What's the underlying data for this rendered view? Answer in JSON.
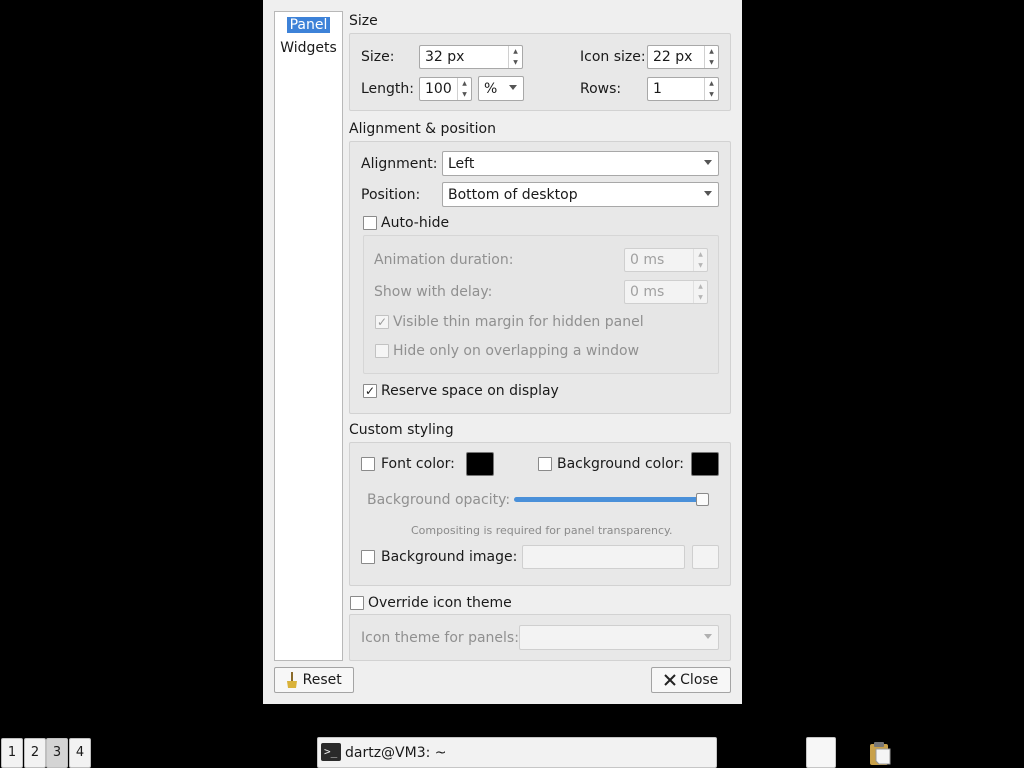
{
  "nav": {
    "items": [
      {
        "label": "Panel",
        "selected": true
      },
      {
        "label": "Widgets",
        "selected": false
      }
    ]
  },
  "size_section": {
    "title": "Size",
    "size_label": "Size:",
    "size_value": "32 px",
    "icon_size_label": "Icon size:",
    "icon_size_value": "22 px",
    "length_label": "Length:",
    "length_value": "100",
    "length_unit": "%",
    "rows_label": "Rows:",
    "rows_value": "1"
  },
  "alignment_section": {
    "title": "Alignment & position",
    "alignment_label": "Alignment:",
    "alignment_value": "Left",
    "position_label": "Position:",
    "position_value": "Bottom of desktop",
    "autohide_label": "Auto-hide",
    "autohide_checked": false,
    "animation_label": "Animation duration:",
    "animation_value": "0 ms",
    "show_delay_label": "Show with delay:",
    "show_delay_value": "0 ms",
    "thin_margin_label": "Visible thin margin for hidden panel",
    "thin_margin_checked": true,
    "overlap_label": "Hide only on overlapping a window",
    "overlap_checked": false,
    "reserve_label": "Reserve space on display",
    "reserve_checked": true
  },
  "styling_section": {
    "title": "Custom styling",
    "font_color_label": "Font color:",
    "font_color_value": "#000000",
    "bg_color_label": "Background color:",
    "bg_color_value": "#000000",
    "opacity_label": "Background opacity:",
    "opacity_fraction": 1.0,
    "compositing_note": "Compositing is required for panel transparency.",
    "bg_image_label": "Background image:",
    "bg_image_value": ""
  },
  "icon_theme_section": {
    "override_label": "Override icon theme",
    "override_checked": false,
    "theme_label": "Icon theme for panels:",
    "theme_value": ""
  },
  "buttons": {
    "reset_label": "Reset",
    "close_label": "Close"
  },
  "taskbar": {
    "desktops": [
      "1",
      "2",
      "3",
      "4"
    ],
    "active_desktop": "3",
    "task_label": "dartz@VM3: ~",
    "task_icon": "terminal-icon",
    "tray_icon": "clipboard-icon"
  },
  "colors": {
    "selection": "#3d82d8",
    "slider": "#4a90d9",
    "dialog_bg": "#efefef"
  }
}
